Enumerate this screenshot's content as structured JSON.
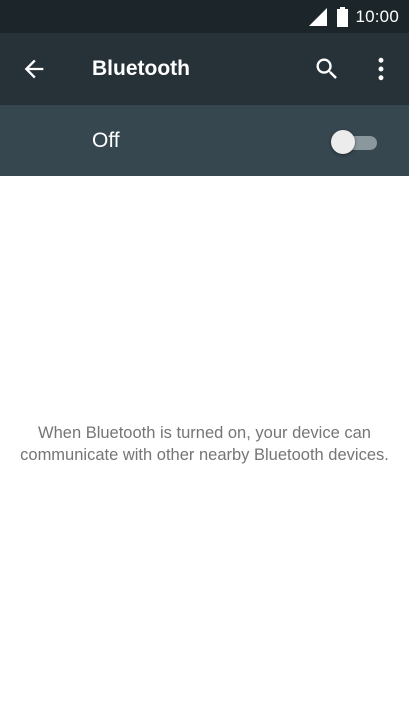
{
  "status_bar": {
    "time": "10:00",
    "icons": [
      "cell-signal-icon",
      "battery-icon"
    ]
  },
  "toolbar": {
    "title": "Bluetooth",
    "icons": [
      "back-arrow-icon",
      "search-icon",
      "more-vert-icon"
    ]
  },
  "bluetooth_switch": {
    "label": "Off",
    "state": "off"
  },
  "empty_state": {
    "message": "When Bluetooth is turned on, your device can communicate with other nearby Bluetooth devices."
  },
  "colors": {
    "status_bar": "#1c2529",
    "toolbar": "#263238",
    "switch_bar": "#37474f",
    "body_text": "#757575"
  }
}
